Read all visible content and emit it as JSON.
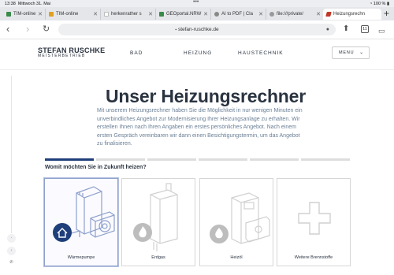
{
  "status": {
    "time": "13:38",
    "date": "Mittwoch 31. Mai",
    "battery": "100 %"
  },
  "tabs": [
    {
      "label": "TIM-online",
      "close": "✕"
    },
    {
      "label": "TIM-online",
      "close": "✕"
    },
    {
      "label": "herkenrather s",
      "close": "✕"
    },
    {
      "label": "GEOportal.NRW",
      "close": "✕"
    },
    {
      "label": "AI to PDF | Cla",
      "close": "✕"
    },
    {
      "label": "file:///private/",
      "close": "✕"
    },
    {
      "label": "Heizungsrechn",
      "close": "✕"
    }
  ],
  "browser": {
    "url": "stefan-ruschke.de",
    "tab_count": "11",
    "back": "‹",
    "forward": "›",
    "reload": "↻",
    "new_tab": "+",
    "sidebar": "▭",
    "share": "⬆",
    "mic": "🎙",
    "lock": "🔒"
  },
  "site": {
    "logo_name": "STEFAN RUSCHKE",
    "logo_sub": "MEISTERBETRIEB",
    "nav": [
      "BAD",
      "HEIZUNG",
      "HAUSTECHNIK"
    ],
    "menu_label": "MENU",
    "menu_chevron": "⌄"
  },
  "side_icons": [
    "◦",
    "‹",
    "✆"
  ],
  "content": {
    "title": "Unser Heizungsrechner",
    "intro": "Mit unserem Heizungsrechner haben Sie die Möglichkeit in nur wenigen Minuten ein unverbindliches Angebot zur Modernisierung Ihrer Heizungsanlage zu erhalten. Wir erstellen Ihnen nach Ihren Angaben ein erstes persönliches Angebot. Nach einem ersten Gespräch vereinbaren wir dann einen Besichtigungstermin, um das Angebot zu finalisieren.",
    "progress": {
      "current_step": 1,
      "total_steps": 6
    },
    "question": "Womit möchten Sie in Zukunft heizen?",
    "options": [
      {
        "label": "Wärmepumpe",
        "icon": "heat-pump-icon",
        "selected": true
      },
      {
        "label": "Erdgas",
        "icon": "gas-boiler-icon",
        "selected": false
      },
      {
        "label": "Heizöl",
        "icon": "oil-boiler-icon",
        "selected": false
      },
      {
        "label": "Weitere Brennstoffe",
        "icon": "plus-icon",
        "selected": false
      }
    ]
  },
  "colors": {
    "brand_dark": "#2a3340",
    "accent": "#1f3f7a",
    "text_muted": "#6a7f96",
    "selected_border": "#8ea0cc"
  }
}
